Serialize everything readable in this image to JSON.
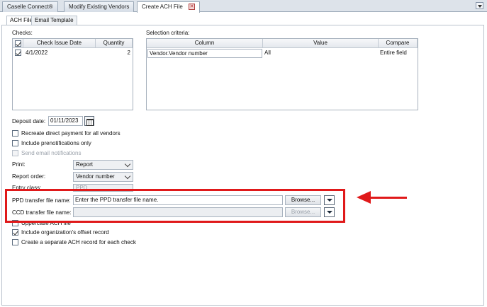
{
  "tabs": [
    {
      "label": "Caselle Connect®"
    },
    {
      "label": "Modify Existing Vendors"
    },
    {
      "label": "Create ACH File"
    }
  ],
  "inner_tabs": [
    {
      "label": "ACH File"
    },
    {
      "label": "Email Template"
    }
  ],
  "checks": {
    "label": "Checks:",
    "columns": [
      "Check Issue Date",
      "Quantity"
    ],
    "rows": [
      {
        "date": "4/1/2022",
        "quantity": "2",
        "checked": true
      }
    ]
  },
  "selection": {
    "label": "Selection criteria:",
    "columns": [
      "Column",
      "Value",
      "Compare"
    ],
    "rows": [
      {
        "column": "Vendor.Vendor number",
        "value": "All",
        "compare": "Entire field"
      }
    ]
  },
  "deposit": {
    "label": "Deposit date:",
    "value": "01/11/2023"
  },
  "options": [
    {
      "label": "Recreate direct payment for all vendors",
      "checked": false,
      "disabled": false
    },
    {
      "label": "Include prenotifications only",
      "checked": false,
      "disabled": false
    },
    {
      "label": "Send email notifications",
      "checked": false,
      "disabled": true
    }
  ],
  "print": {
    "label": "Print:",
    "value": "Report"
  },
  "report_order": {
    "label": "Report order:",
    "value": "Vendor number"
  },
  "entry_class": {
    "label": "Entry class:",
    "value": "PPD"
  },
  "ppd": {
    "label": "PPD transfer file name:",
    "value": "Enter the PPD transfer file name.",
    "button": "Browse..."
  },
  "ccd": {
    "label": "CCD transfer file name:",
    "value": "",
    "button": "Browse..."
  },
  "bottom_options": [
    {
      "label": "Uppercase ACH file",
      "checked": false
    },
    {
      "label": "Include organization's offset record",
      "checked": true
    },
    {
      "label": "Create a separate ACH record for each check",
      "checked": false
    }
  ],
  "colors": {
    "highlight": "#e0191a"
  }
}
